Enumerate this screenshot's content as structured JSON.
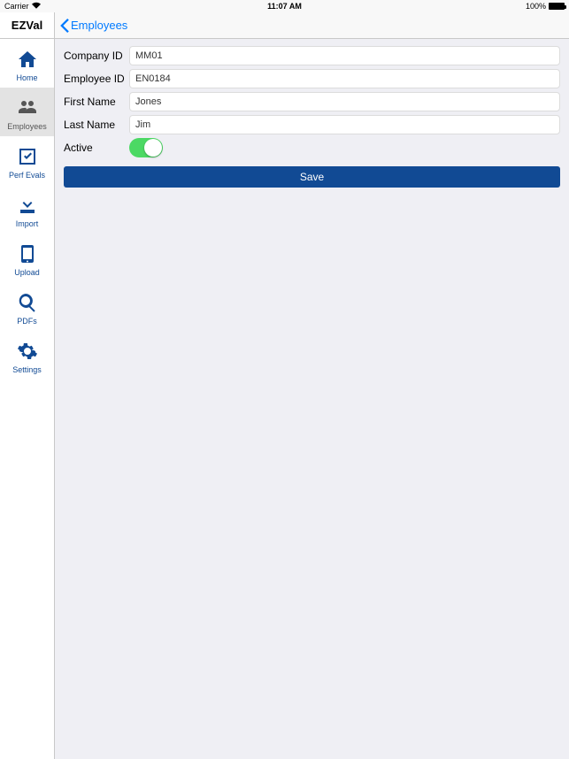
{
  "statusbar": {
    "carrier": "Carrier",
    "time": "11:07 AM",
    "battery_pct": "100%"
  },
  "sidebar": {
    "title": "EZVal",
    "items": [
      {
        "label": "Home"
      },
      {
        "label": "Employees"
      },
      {
        "label": "Perf Evals"
      },
      {
        "label": "Import"
      },
      {
        "label": "Upload"
      },
      {
        "label": "PDFs"
      },
      {
        "label": "Settings"
      }
    ]
  },
  "nav": {
    "back_label": "Employees"
  },
  "form": {
    "company_id_label": "Company ID",
    "company_id_value": "MM01",
    "employee_id_label": "Employee ID",
    "employee_id_value": "EN0184",
    "first_name_label": "First Name",
    "first_name_value": "Jones",
    "last_name_label": "Last Name",
    "last_name_value": "Jim",
    "active_label": "Active",
    "active_value": true,
    "save_label": "Save"
  }
}
